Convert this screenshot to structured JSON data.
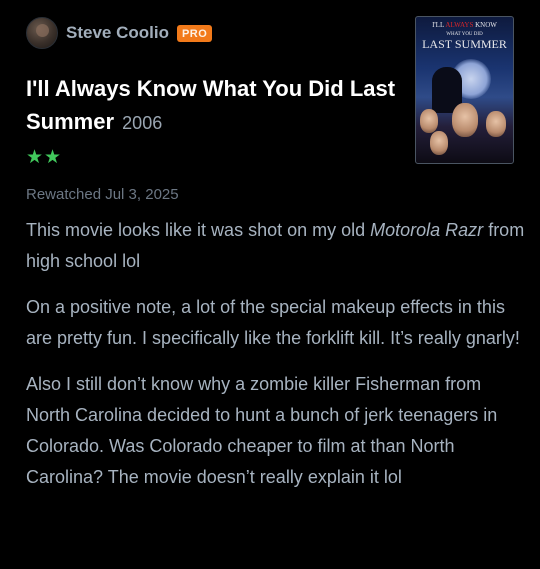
{
  "author": {
    "name": "Steve Coolio",
    "badge": "PRO"
  },
  "film": {
    "title": "I'll Always Know What You Did Last Summer",
    "year": "2006",
    "rating_stars": "★★",
    "rating_value": 2,
    "poster": {
      "title_line1_prefix": "I'LL ",
      "title_line1_red": "ALWAYS",
      "title_line1_suffix": " KNOW",
      "title_line2": "WHAT YOU DID",
      "title_line3": "LAST SUMMER"
    }
  },
  "review": {
    "date_line": "Rewatched Jul 3, 2025",
    "p1_text_a": "This movie looks like it was shot on my old ",
    "p1_italic": "Motorola Razr",
    "p1_text_b": " from high school lol",
    "p2": "On a positive note, a lot of the special makeup effects in this are pretty fun.  I specifically like the forklift kill.  It’s really gnarly!",
    "p3": "Also I still don’t know why a zombie killer Fisherman from North Carolina decided to hunt a bunch of jerk teenagers in Colorado.  Was Colorado cheaper to film at than North Carolina?  The movie doesn’t really explain it lol"
  },
  "colors": {
    "background": "#000000",
    "body_text": "#a7b3c0",
    "title_text": "#ffffff",
    "star_green": "#41c85c",
    "pro_badge": "#f27a1a"
  }
}
